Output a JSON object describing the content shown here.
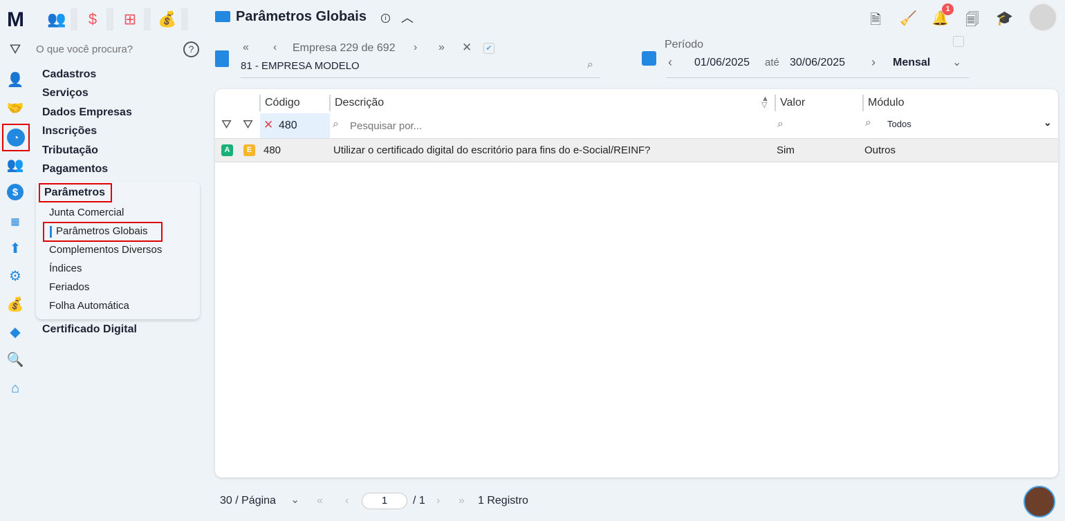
{
  "app": {
    "logo": "M"
  },
  "top_modules": [
    {
      "icon": "people-icon"
    },
    {
      "icon": "dollar-icon"
    },
    {
      "icon": "calculator-icon"
    },
    {
      "icon": "money-bag-icon"
    }
  ],
  "search": {
    "placeholder": "O que você procura?"
  },
  "menu": {
    "items": [
      "Cadastros",
      "Serviços",
      "Dados Empresas",
      "Inscrições",
      "Tributação",
      "Pagamentos"
    ],
    "expanded": {
      "label": "Parâmetros",
      "children": [
        "Junta Comercial",
        "Parâmetros Globais",
        "Complementos Diversos",
        "Índices",
        "Feriados",
        "Folha Automática"
      ],
      "active": "Parâmetros Globais"
    },
    "after": [
      "Certificado Digital"
    ]
  },
  "header": {
    "title": "Parâmetros Globais",
    "notification_count": "1"
  },
  "company": {
    "nav_label": "Empresa",
    "current": "229",
    "of": "de",
    "total": "692",
    "value": "81 - EMPRESA MODELO"
  },
  "period": {
    "label": "Período",
    "start": "01/06/2025",
    "until": "até",
    "end": "30/06/2025",
    "type": "Mensal"
  },
  "table": {
    "columns": [
      "Código",
      "Descrição",
      "Valor",
      "Módulo"
    ],
    "filters": {
      "codigo": "480",
      "descricao_placeholder": "Pesquisar por...",
      "modulo": "Todos"
    },
    "rows": [
      {
        "badge_a": "A",
        "badge_e": "E",
        "codigo": "480",
        "descricao": "Utilizar o certificado digital do escritório para fins do e-Social/REINF?",
        "valor": "Sim",
        "modulo": "Outros"
      }
    ]
  },
  "pagination": {
    "per_page": "30 / Página",
    "page": "1",
    "total_pages": "/ 1",
    "records": "1 Registro"
  },
  "colors": {
    "accent": "#2389e0",
    "highlight": "#e00000",
    "bg": "#eef3f8"
  }
}
